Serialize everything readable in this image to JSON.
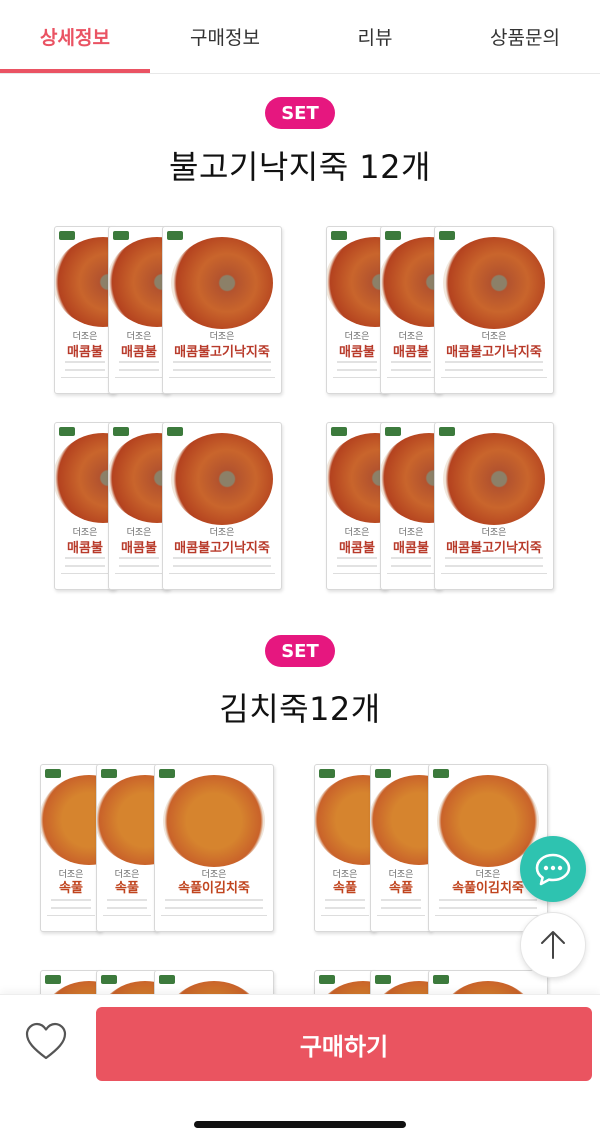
{
  "tabs": [
    {
      "label": "상세정보",
      "active": true
    },
    {
      "label": "구매정보",
      "active": false
    },
    {
      "label": "리뷰",
      "active": false
    },
    {
      "label": "상품문의",
      "active": false
    }
  ],
  "sections": [
    {
      "badge": "SET",
      "title": "불고기낙지죽 12개",
      "product": {
        "brand": "더조은",
        "name_short": "매콤불",
        "name_full": "매콤불고기낙지죽",
        "subtitle": "SPICY BEEF AND OCTOPUS PORRIDGE"
      }
    },
    {
      "badge": "SET",
      "title": "김치죽12개",
      "product": {
        "brand": "더조은",
        "name_short": "속풀",
        "name_full": "속풀이김치죽",
        "subtitle": "SPICY KIMCHI PORRIDGE"
      }
    }
  ],
  "bottom_bar": {
    "buy_label": "구매하기"
  },
  "colors": {
    "accent": "#ea5363",
    "badge": "#e6177f",
    "chat_fab": "#2ec3b0",
    "buy_button": "#ea5460"
  },
  "icons": {
    "wishlist": "heart-icon",
    "chat": "chat-bubble-icon",
    "scroll_top": "arrow-up-icon"
  }
}
